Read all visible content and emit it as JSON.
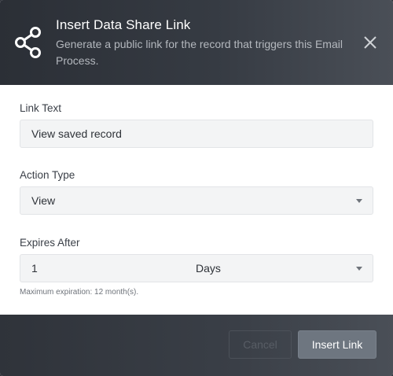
{
  "dialog": {
    "title": "Insert Data Share Link",
    "subtitle": "Generate a public link for the record that triggers this Email Process."
  },
  "fields": {
    "link_text": {
      "label": "Link Text",
      "value": "View saved record"
    },
    "action_type": {
      "label": "Action Type",
      "value": "View"
    },
    "expires_after": {
      "label": "Expires After",
      "amount": "1",
      "unit": "Days",
      "hint": "Maximum expiration: 12 month(s)."
    }
  },
  "footer": {
    "cancel_label": "Cancel",
    "insert_label": "Insert Link"
  },
  "icons": {
    "header": "share-icon",
    "close": "close-icon",
    "caret": "caret-down-icon"
  },
  "colors": {
    "header_bg": "#363b43",
    "primary_button": "#6e7680",
    "input_bg": "#f3f4f5"
  }
}
